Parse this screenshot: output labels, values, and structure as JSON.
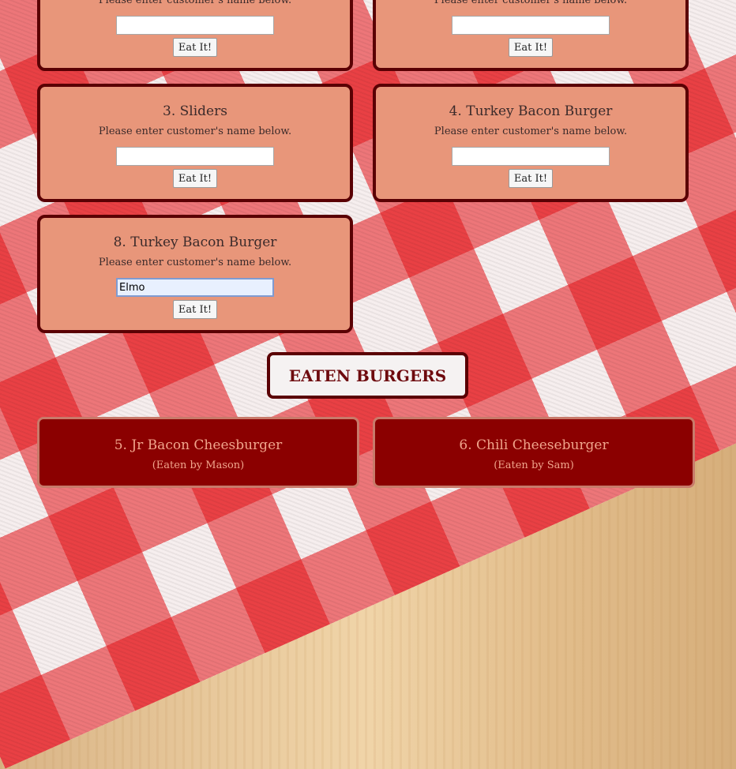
{
  "forms": {
    "prompt_text": "Please enter customer's name below.",
    "button_label": "Eat It!",
    "cards": [
      {
        "title": "",
        "input_value": ""
      },
      {
        "title": "",
        "input_value": ""
      },
      {
        "title": "3. Sliders",
        "input_value": ""
      },
      {
        "title": "4. Turkey Bacon Burger",
        "input_value": ""
      },
      {
        "title": "8. Turkey Bacon Burger",
        "input_value": "Elmo"
      }
    ]
  },
  "eaten_section": {
    "heading": "EATEN BURGERS",
    "items": [
      {
        "title": "5. Jr Bacon Cheesburger",
        "eaten_by": "(Eaten by Mason)"
      },
      {
        "title": "6. Chili Cheeseburger",
        "eaten_by": "(Eaten by Sam)"
      }
    ]
  },
  "colors": {
    "card_background": "#e8967a",
    "card_border": "#5a0004",
    "eaten_background": "#8b0000",
    "eaten_text": "#f0a58c"
  }
}
